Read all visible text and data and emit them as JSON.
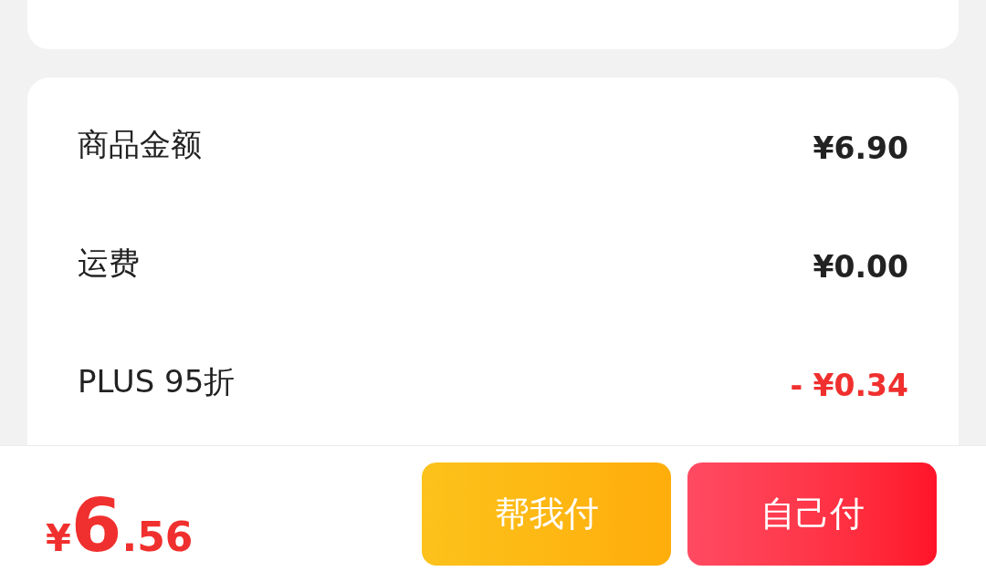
{
  "summary": {
    "rows": [
      {
        "label": "商品金额",
        "value": "¥6.90",
        "kind": "normal"
      },
      {
        "label": "运费",
        "value": "¥0.00",
        "kind": "normal"
      },
      {
        "label": "PLUS 95折",
        "value": "- ¥0.34",
        "kind": "discount"
      }
    ]
  },
  "footer": {
    "total": {
      "currency": "¥",
      "integer": "6",
      "decimal": ".56"
    },
    "buttons": [
      {
        "label": "帮我付",
        "kind": "secondary"
      },
      {
        "label": "自己付",
        "kind": "primary"
      }
    ]
  }
}
